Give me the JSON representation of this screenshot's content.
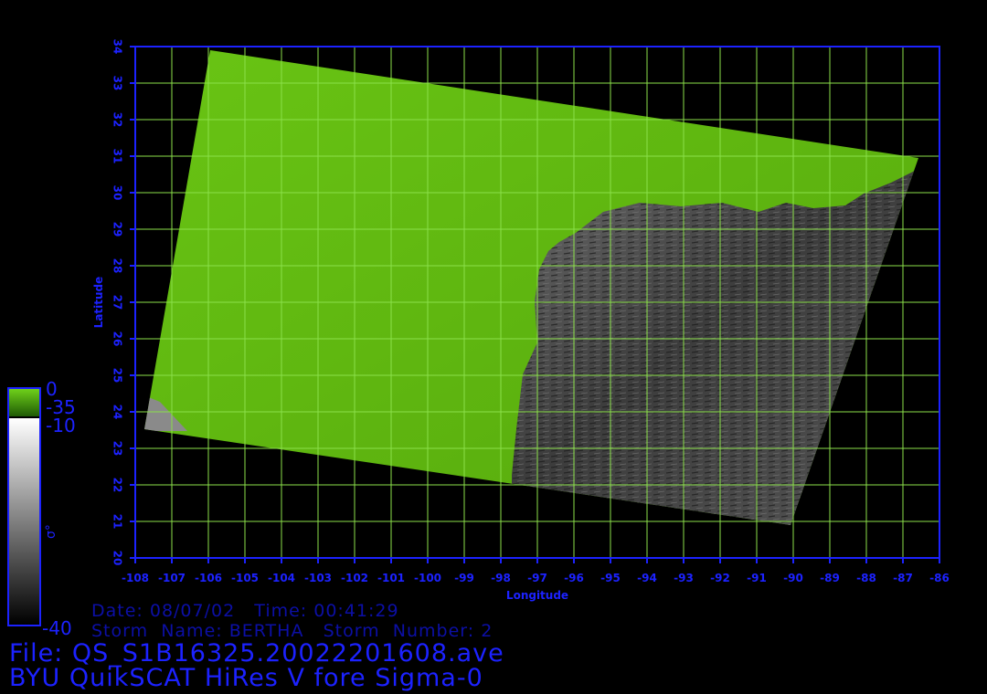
{
  "map": {
    "lon_ticks": [
      "-108",
      "-107",
      "-106",
      "-105",
      "-104",
      "-103",
      "-102",
      "-101",
      "-100",
      "-99",
      "-98",
      "-97",
      "-96",
      "-95",
      "-94",
      "-93",
      "-92",
      "-91",
      "-90",
      "-89",
      "-88",
      "-87",
      "-86"
    ],
    "lat_ticks": [
      "20",
      "21",
      "22",
      "23",
      "24",
      "25",
      "26",
      "27",
      "28",
      "29",
      "30",
      "31",
      "32",
      "33",
      "34"
    ],
    "xlabel": "Longitude",
    "ylabel": "Latitude",
    "lon_range": [
      -108,
      -86
    ],
    "lat_range": [
      20,
      34
    ],
    "colors": {
      "axis": "#1c22ff",
      "grid": "#8be04a",
      "land": "#5fb80f",
      "ocean": "#4a4a4a",
      "background": "#000000"
    }
  },
  "colorbar": {
    "land_top": "0",
    "land_bottom": "-35",
    "ocean_top": "-10",
    "ocean_bottom": "-40",
    "symbol": "σ°"
  },
  "info": {
    "date_time": "Date: 08/07/02   Time: 00:41:29",
    "storm": "Storm  Name: BERTHA   Storm  Number: 2"
  },
  "footer": {
    "file": "File: QS_S1B16325.20022201608.ave",
    "product": "BYU QuikSCAT HiRes V fore Sigma-0"
  }
}
